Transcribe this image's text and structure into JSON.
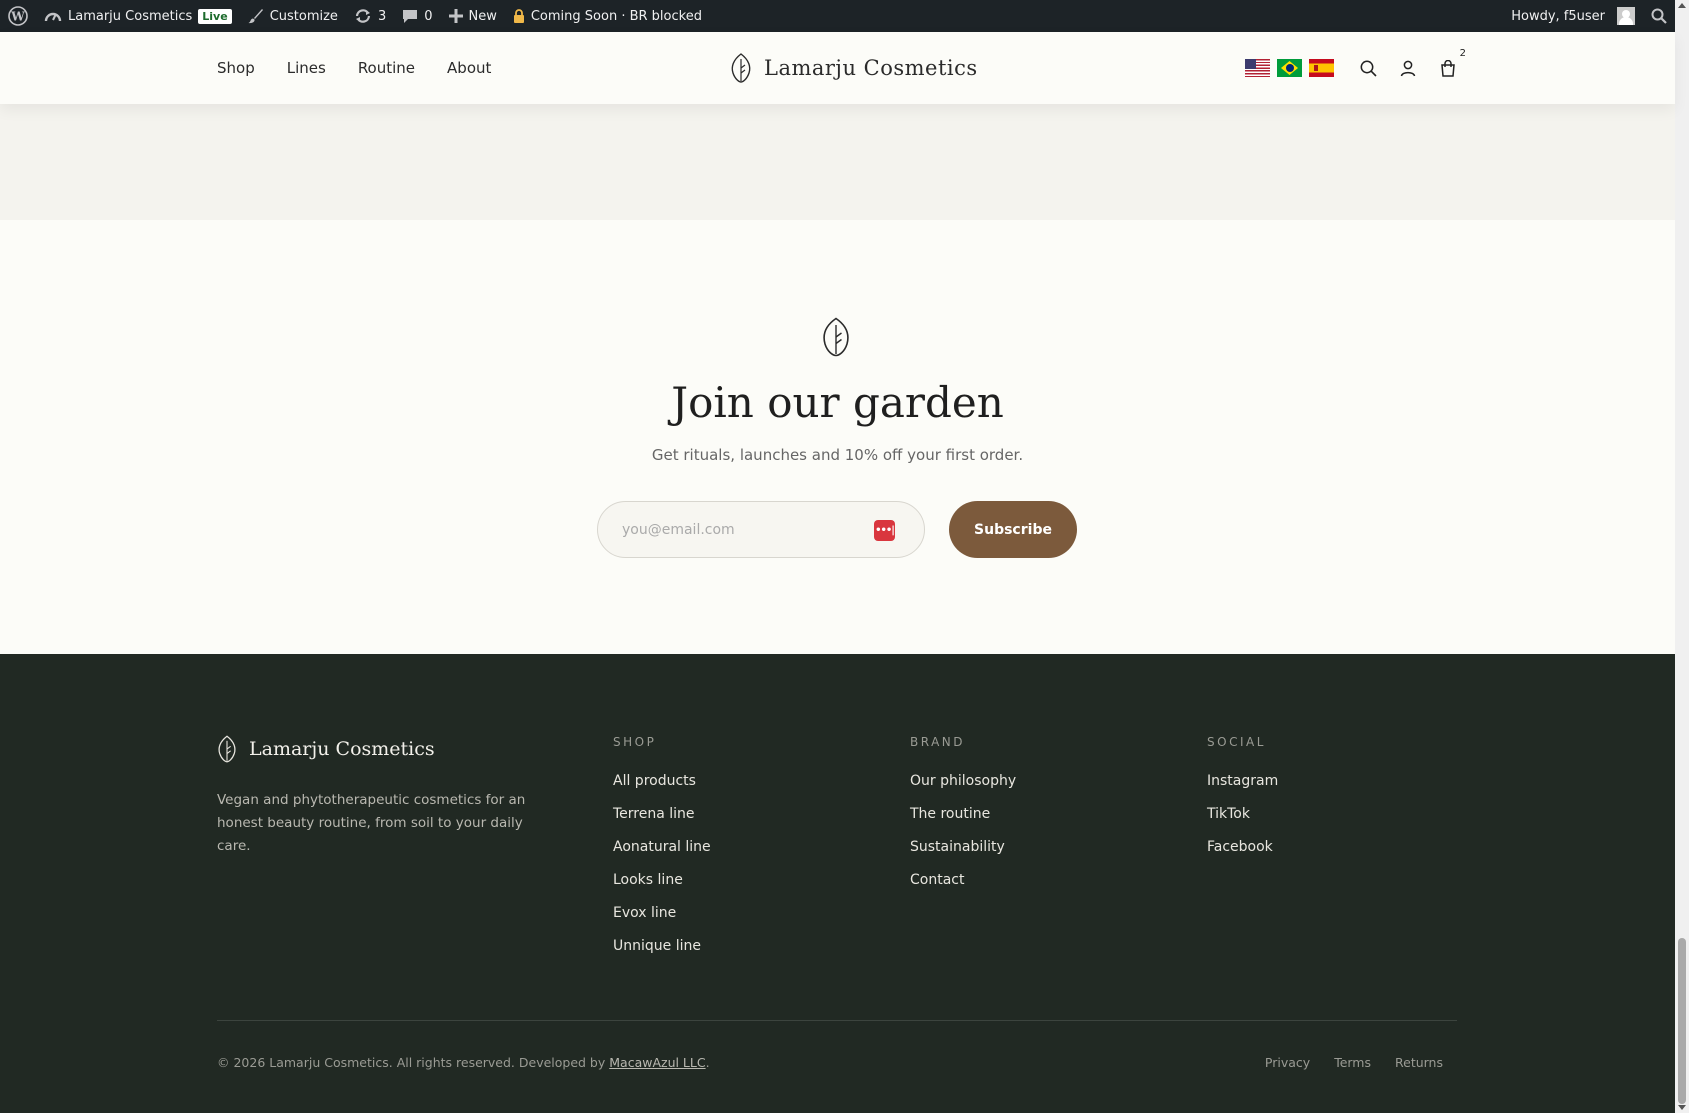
{
  "adminbar": {
    "site_name": "Lamarju Cosmetics",
    "live_badge": "Live",
    "customize": "Customize",
    "updates_count": "3",
    "comments_count": "0",
    "new_label": "New",
    "coming_soon": "Coming Soon · BR blocked",
    "howdy": "Howdy, f5user"
  },
  "header": {
    "nav": [
      "Shop",
      "Lines",
      "Routine",
      "About"
    ],
    "logo_text": "Lamarju Cosmetics",
    "cart_count": "2",
    "flags": [
      "us-flag",
      "br-flag",
      "es-flag"
    ]
  },
  "newsletter": {
    "title": "Join our garden",
    "subtitle": "Get rituals, launches and 10% off your first order.",
    "email_placeholder": "you@email.com",
    "subscribe_label": "Subscribe",
    "password_manager_glyph": "•••|"
  },
  "footer": {
    "logo_text": "Lamarju Cosmetics",
    "description": "Vegan and phytotherapeutic cosmetics for an honest beauty routine, from soil to your daily care.",
    "columns": [
      {
        "heading": "SHOP",
        "links": [
          "All products",
          "Terrena line",
          "Aonatural line",
          "Looks line",
          "Evox line",
          "Unnique line"
        ]
      },
      {
        "heading": "BRAND",
        "links": [
          "Our philosophy",
          "The routine",
          "Sustainability",
          "Contact"
        ]
      },
      {
        "heading": "SOCIAL",
        "links": [
          "Instagram",
          "TikTok",
          "Facebook"
        ]
      }
    ],
    "copyright_prefix": "© 2026 Lamarju Cosmetics. All rights reserved. Developed by ",
    "developer": "MacawAzul LLC",
    "copyright_suffix": ".",
    "legal": [
      "Privacy",
      "Terms",
      "Returns"
    ]
  },
  "colors": {
    "adminbar_bg": "#1d2327",
    "page_bg": "#fcfcf8",
    "strip_bg": "#f4f3ee",
    "accent_brown": "#7c5a3c",
    "footer_bg": "#212923"
  }
}
